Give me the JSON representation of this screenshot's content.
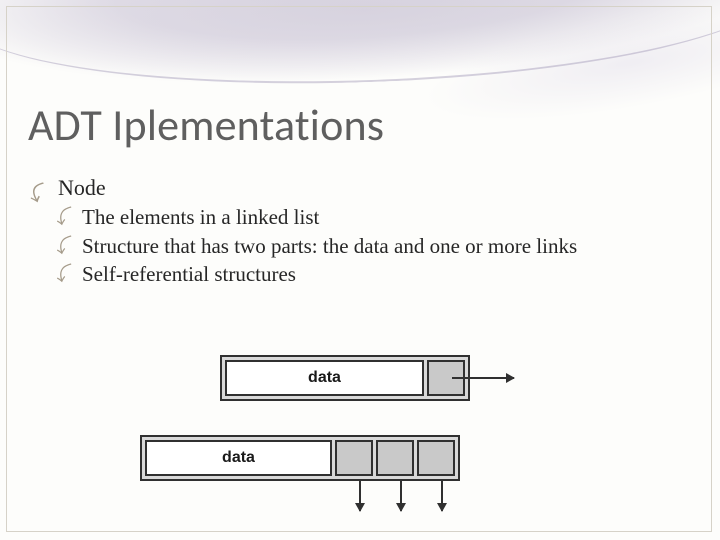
{
  "title": "ADT Iplementations",
  "bullets": {
    "l1": "Node",
    "l2_0": "The elements in a linked list",
    "l2_1": "Structure that has two parts:  the data and one or more links",
    "l2_2": "Self-referential structures"
  },
  "diagram": {
    "node1_label": "data",
    "node2_label": "data"
  }
}
